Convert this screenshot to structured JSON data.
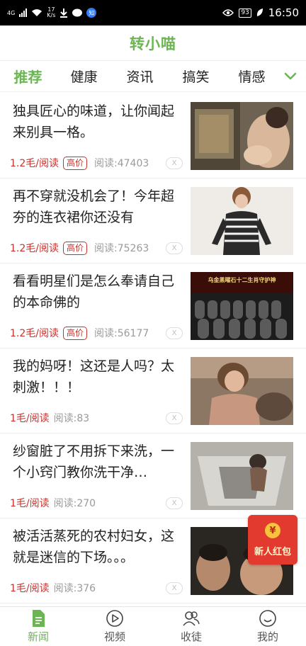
{
  "status_bar": {
    "network": "4G",
    "speed_value": "17",
    "speed_unit": "K/s",
    "notification_badge": "知",
    "battery": "93",
    "time": "16:50"
  },
  "header": {
    "title": "转小喵"
  },
  "tabs": [
    {
      "label": "推荐",
      "active": true
    },
    {
      "label": "健康"
    },
    {
      "label": "资讯"
    },
    {
      "label": "搞笑"
    },
    {
      "label": "情感"
    }
  ],
  "feed": {
    "close_label": "X",
    "items": [
      {
        "title": "独具匠心的味道，让你闻起来别具一格。",
        "price": "1.2毛/阅读",
        "badge": "高价",
        "reads": "阅读:47403"
      },
      {
        "title": "再不穿就没机会了！今年超夯的连衣裙你还没有",
        "price": "1.2毛/阅读",
        "badge": "高价",
        "reads": "阅读:75263"
      },
      {
        "title": "看看明星们是怎么奉请自己的本命佛的",
        "price": "1.2毛/阅读",
        "badge": "高价",
        "reads": "阅读:56177",
        "thumb_caption": "乌金黑曜石十二生肖守护神"
      },
      {
        "title": "我的妈呀！这还是人吗？太刺激！！！",
        "price": "1毛/阅读",
        "reads": "阅读:83"
      },
      {
        "title": "纱窗脏了不用拆下来洗，一个小窍门教你洗干净…",
        "price": "1毛/阅读",
        "reads": "阅读:270"
      },
      {
        "title": "被活活蒸死的农村妇女，这就是迷信的下场。。。",
        "price": "1毛/阅读",
        "reads": "阅读:376"
      }
    ]
  },
  "red_packet": {
    "coin_symbol": "¥",
    "label": "新人红包"
  },
  "bottom_nav": [
    {
      "label": "新闻",
      "icon": "news-icon",
      "active": true
    },
    {
      "label": "视频",
      "icon": "play-icon"
    },
    {
      "label": "收徒",
      "icon": "people-icon"
    },
    {
      "label": "我的",
      "icon": "smile-icon"
    }
  ],
  "colors": {
    "accent": "#6bb552",
    "price_red": "#c5322d",
    "red_packet": "#e23a2e"
  }
}
